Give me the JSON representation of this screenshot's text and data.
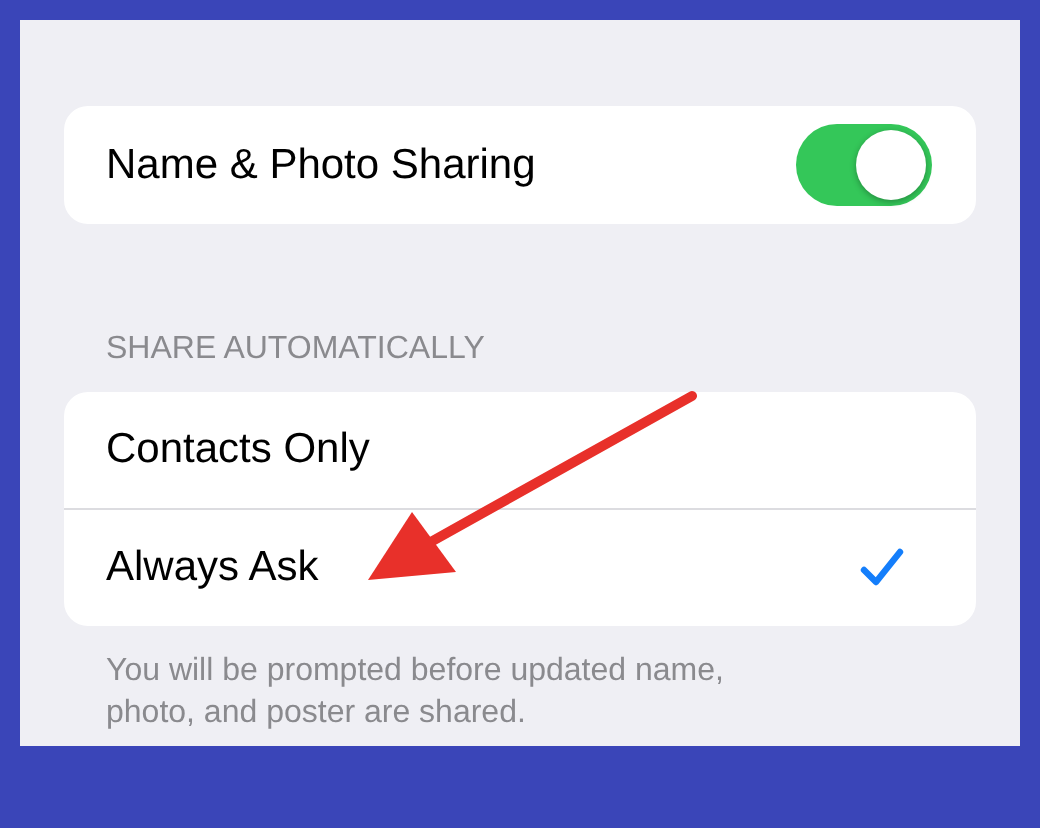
{
  "toggle_row": {
    "label": "Name & Photo Sharing",
    "on": true
  },
  "share_section": {
    "header": "SHARE AUTOMATICALLY",
    "options": [
      {
        "label": "Contacts Only",
        "selected": false
      },
      {
        "label": "Always Ask",
        "selected": true
      }
    ],
    "footer": "You will be prompted before updated name, photo, and poster are shared."
  },
  "annotation": {
    "kind": "arrow"
  }
}
